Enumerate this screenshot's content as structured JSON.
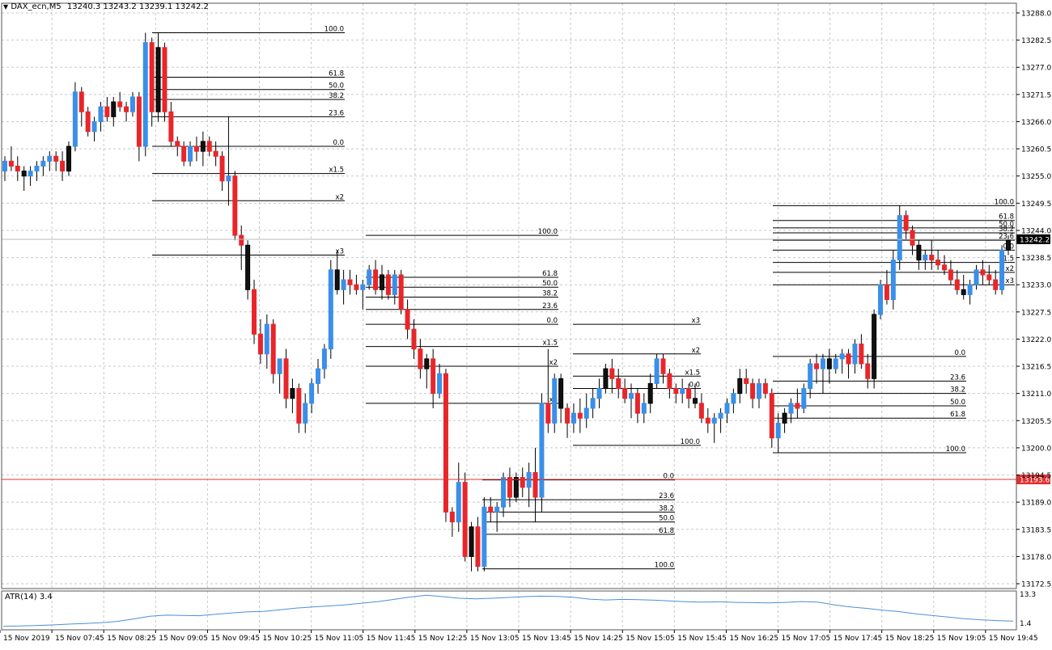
{
  "header": {
    "symbol_label": "DAX_ecn,M5",
    "ohlc_label": "13240.3 13243.2 13239.1 13242.2"
  },
  "indicator": {
    "label": "ATR(14) 3.4",
    "axis_top": "13.3",
    "axis_bottom": "1.4"
  },
  "price_axis": {
    "labels": [
      "13288.0",
      "13282.5",
      "13277.0",
      "13271.5",
      "13266.0",
      "13260.5",
      "13255.0",
      "13249.5",
      "13244.0",
      "13238.5",
      "13233.0",
      "13227.5",
      "13222.0",
      "13216.5",
      "13211.0",
      "13205.5",
      "13200.0",
      "13194.5",
      "13189.0",
      "13183.5",
      "13178.0",
      "13172.5"
    ],
    "current_price": "13242.2",
    "red_line_price": "13193.6"
  },
  "time_axis": {
    "labels": [
      "15 Nov 2019",
      "15 Nov 07:45",
      "15 Nov 08:25",
      "15 Nov 09:05",
      "15 Nov 09:45",
      "15 Nov 10:25",
      "15 Nov 11:05",
      "15 Nov 11:45",
      "15 Nov 12:25",
      "15 Nov 13:05",
      "15 Nov 13:45",
      "15 Nov 14:25",
      "15 Nov 15:05",
      "15 Nov 15:45",
      "15 Nov 16:25",
      "15 Nov 17:05",
      "15 Nov 17:45",
      "15 Nov 18:25",
      "15 Nov 19:05",
      "15 Nov 19:45"
    ]
  },
  "colors": {
    "bull": "#3a8fe8",
    "bear": "#e8262a",
    "neutral": "#111111",
    "grid": "#c8c8c8",
    "red_line": "#e03030",
    "atr": "#4a90d9",
    "fib_lines": "#000000"
  },
  "chart_data": {
    "type": "candlestick",
    "symbol": "DAX_ecn",
    "timeframe": "M5",
    "ylim": [
      13172.5,
      13288.0
    ],
    "candles": [
      [
        13256,
        13259,
        13254,
        13258
      ],
      [
        13258,
        13261,
        13256,
        13257
      ],
      [
        13257,
        13259,
        13254,
        13256
      ],
      [
        13256,
        13257,
        13252,
        13255
      ],
      [
        13255,
        13257,
        13253,
        13256
      ],
      [
        13256,
        13258,
        13254,
        13257
      ],
      [
        13257,
        13259,
        13255,
        13258
      ],
      [
        13258,
        13260,
        13256,
        13259
      ],
      [
        13259,
        13260,
        13256,
        13258
      ],
      [
        13258,
        13260,
        13254,
        13256
      ],
      [
        13256,
        13262,
        13255,
        13261
      ],
      [
        13261,
        13274,
        13260,
        13272
      ],
      [
        13272,
        13273,
        13265,
        13268
      ],
      [
        13268,
        13269,
        13263,
        13264
      ],
      [
        13264,
        13267,
        13262,
        13266
      ],
      [
        13266,
        13270,
        13264,
        13269
      ],
      [
        13269,
        13271,
        13266,
        13267
      ],
      [
        13267,
        13271,
        13265,
        13270
      ],
      [
        13270,
        13272,
        13268,
        13269
      ],
      [
        13269,
        13270,
        13266,
        13268
      ],
      [
        13268,
        13272,
        13267,
        13271
      ],
      [
        13271,
        13272,
        13258,
        13261
      ],
      [
        13261,
        13284,
        13259,
        13282
      ],
      [
        13282,
        13283,
        13265,
        13268
      ],
      [
        13268,
        13284,
        13266,
        13281
      ],
      [
        13281,
        13282,
        13266,
        13268
      ],
      [
        13268,
        13270,
        13261,
        13262
      ],
      [
        13262,
        13263,
        13259,
        13261
      ],
      [
        13261,
        13262,
        13257,
        13258
      ],
      [
        13258,
        13262,
        13257,
        13261
      ],
      [
        13261,
        13263,
        13258,
        13260
      ],
      [
        13260,
        13264,
        13257,
        13262
      ],
      [
        13262,
        13263,
        13259,
        13260
      ],
      [
        13260,
        13262,
        13257,
        13259
      ],
      [
        13259,
        13260,
        13252,
        13254
      ],
      [
        13254,
        13267,
        13249,
        13255
      ],
      [
        13255,
        13256,
        13242,
        13243
      ],
      [
        13243,
        13245,
        13236,
        13241
      ],
      [
        13241,
        13242,
        13230,
        13232
      ],
      [
        13232,
        13234,
        13221,
        13223
      ],
      [
        13223,
        13226,
        13217,
        13219
      ],
      [
        13219,
        13227,
        13216,
        13225
      ],
      [
        13225,
        13226,
        13213,
        13215
      ],
      [
        13215,
        13218,
        13211,
        13218
      ],
      [
        13218,
        13220,
        13208,
        13210
      ],
      [
        13210,
        13214,
        13207,
        13212
      ],
      [
        13212,
        13213,
        13203,
        13205
      ],
      [
        13205,
        13211,
        13203,
        13209
      ],
      [
        13209,
        13214,
        13207,
        13213
      ],
      [
        13213,
        13218,
        13211,
        13216
      ],
      [
        13216,
        13221,
        13214,
        13220
      ],
      [
        13220,
        13238,
        13218,
        13236
      ],
      [
        13236,
        13240,
        13231,
        13232
      ],
      [
        13232,
        13236,
        13229,
        13234
      ],
      [
        13234,
        13236,
        13231,
        13233
      ],
      [
        13233,
        13235,
        13231,
        13232
      ],
      [
        13232,
        13234,
        13228,
        13233
      ],
      [
        13233,
        13237,
        13232,
        13236
      ],
      [
        13236,
        13238,
        13231,
        13232
      ],
      [
        13232,
        13237,
        13230,
        13235
      ],
      [
        13235,
        13236,
        13230,
        13231
      ],
      [
        13231,
        13236,
        13229,
        13235
      ],
      [
        13235,
        13236,
        13227,
        13228
      ],
      [
        13228,
        13230,
        13222,
        13224
      ],
      [
        13224,
        13226,
        13218,
        13220
      ],
      [
        13220,
        13222,
        13214,
        13216
      ],
      [
        13216,
        13219,
        13212,
        13218
      ],
      [
        13218,
        13220,
        13208,
        13211
      ],
      [
        13211,
        13217,
        13210,
        13215
      ],
      [
        13215,
        13216,
        13185,
        13187
      ],
      [
        13187,
        13188,
        13182,
        13185
      ],
      [
        13185,
        13197,
        13183,
        13193
      ],
      [
        13193,
        13195,
        13177,
        13178
      ],
      [
        13178,
        13185,
        13175,
        13184
      ],
      [
        13184,
        13186,
        13175,
        13176
      ],
      [
        13176,
        13190,
        13175,
        13188
      ],
      [
        13188,
        13190,
        13185,
        13187
      ],
      [
        13187,
        13189,
        13183,
        13188
      ],
      [
        13188,
        13195,
        13186,
        13194
      ],
      [
        13194,
        13196,
        13188,
        13190
      ],
      [
        13190,
        13195,
        13189,
        13194
      ],
      [
        13194,
        13196,
        13190,
        13192
      ],
      [
        13192,
        13197,
        13188,
        13195
      ],
      [
        13195,
        13200,
        13185,
        13190
      ],
      [
        13190,
        13211,
        13187,
        13209
      ],
      [
        13209,
        13220,
        13203,
        13205
      ],
      [
        13205,
        13215,
        13203,
        13214
      ],
      [
        13214,
        13215,
        13205,
        13208
      ],
      [
        13208,
        13209,
        13202,
        13205
      ],
      [
        13205,
        13209,
        13203,
        13207
      ],
      [
        13207,
        13210,
        13203,
        13206
      ],
      [
        13206,
        13211,
        13204,
        13208
      ],
      [
        13208,
        13212,
        13206,
        13210
      ],
      [
        13210,
        13214,
        13208,
        13212
      ],
      [
        13212,
        13217,
        13211,
        13216
      ],
      [
        13216,
        13218,
        13211,
        13214
      ],
      [
        13214,
        13216,
        13210,
        13212
      ],
      [
        13212,
        13214,
        13209,
        13210
      ],
      [
        13210,
        13213,
        13206,
        13211
      ],
      [
        13211,
        13212,
        13205,
        13207
      ],
      [
        13207,
        13211,
        13205,
        13209
      ],
      [
        13209,
        13215,
        13207,
        13213
      ],
      [
        13213,
        13219,
        13212,
        13218
      ],
      [
        13218,
        13219,
        13213,
        13215
      ],
      [
        13215,
        13216,
        13210,
        13212
      ],
      [
        13212,
        13213,
        13209,
        13211
      ],
      [
        13211,
        13214,
        13209,
        13212
      ],
      [
        13212,
        13213,
        13208,
        13210
      ],
      [
        13210,
        13213,
        13208,
        13209
      ],
      [
        13209,
        13211,
        13205,
        13206
      ],
      [
        13206,
        13208,
        13203,
        13205
      ],
      [
        13205,
        13207,
        13201,
        13206
      ],
      [
        13206,
        13208,
        13203,
        13207
      ],
      [
        13207,
        13210,
        13205,
        13209
      ],
      [
        13209,
        13212,
        13207,
        13211
      ],
      [
        13211,
        13216,
        13209,
        13214
      ],
      [
        13214,
        13216,
        13211,
        13213
      ],
      [
        13213,
        13214,
        13208,
        13210
      ],
      [
        13210,
        13214,
        13208,
        13213
      ],
      [
        13213,
        13214,
        13210,
        13211
      ],
      [
        13211,
        13212,
        13200,
        13202
      ],
      [
        13202,
        13207,
        13199,
        13205
      ],
      [
        13205,
        13208,
        13203,
        13207
      ],
      [
        13207,
        13210,
        13205,
        13209
      ],
      [
        13209,
        13212,
        13206,
        13208
      ],
      [
        13208,
        13213,
        13207,
        13212
      ],
      [
        13212,
        13218,
        13210,
        13217
      ],
      [
        13217,
        13219,
        13213,
        13216
      ],
      [
        13216,
        13219,
        13211,
        13218
      ],
      [
        13218,
        13220,
        13213,
        13216
      ],
      [
        13216,
        13219,
        13215,
        13218
      ],
      [
        13218,
        13220,
        13215,
        13219
      ],
      [
        13219,
        13220,
        13214,
        13217
      ],
      [
        13217,
        13222,
        13215,
        13221
      ],
      [
        13221,
        13223,
        13216,
        13217
      ],
      [
        13217,
        13219,
        13212,
        13214
      ],
      [
        13214,
        13228,
        13212,
        13227
      ],
      [
        13227,
        13234,
        13226,
        13233
      ],
      [
        13233,
        13236,
        13229,
        13230
      ],
      [
        13230,
        13240,
        13228,
        13238
      ],
      [
        13238,
        13249,
        13236,
        13247
      ],
      [
        13247,
        13248,
        13242,
        13244
      ],
      [
        13244,
        13245,
        13239,
        13241
      ],
      [
        13241,
        13242,
        13236,
        13238
      ],
      [
        13238,
        13240,
        13236,
        13239
      ],
      [
        13239,
        13242,
        13236,
        13238
      ],
      [
        13238,
        13240,
        13236,
        13237
      ],
      [
        13237,
        13239,
        13235,
        13236
      ],
      [
        13236,
        13238,
        13233,
        13234
      ],
      [
        13234,
        13236,
        13231,
        13232
      ],
      [
        13232,
        13235,
        13230,
        13231
      ],
      [
        13231,
        13234,
        13229,
        13233
      ],
      [
        13233,
        13237,
        13232,
        13236
      ],
      [
        13236,
        13238,
        13233,
        13235
      ],
      [
        13235,
        13237,
        13233,
        13234
      ],
      [
        13234,
        13236,
        13231,
        13232
      ],
      [
        13232,
        13241,
        13231,
        13240
      ],
      [
        13240,
        13243,
        13239,
        13242
      ]
    ],
    "current_price": 13242.2,
    "horizontal_line": 13193.6,
    "fibonacci_groups": [
      {
        "labels": [
          "100.0",
          "61.8",
          "50.0",
          "38.2",
          "23.6",
          "0.0",
          "x1.5",
          "x2",
          "x3"
        ],
        "levels": [
          13284,
          13275,
          13272.5,
          13270.5,
          13267,
          13261,
          13255.5,
          13250,
          13239
        ]
      },
      {
        "labels": [
          "100.0",
          "61.8",
          "50.0",
          "38.2",
          "23.6",
          "0.0",
          "x1.5",
          "x2",
          "x3"
        ],
        "levels": [
          13243,
          13234.5,
          13232.5,
          13230.5,
          13228,
          13225,
          13220.5,
          13216.5,
          13209
        ]
      },
      {
        "labels": [
          "0.0",
          "23.6",
          "38.2",
          "50.0",
          "61.8",
          "100.0"
        ],
        "levels": [
          13193.5,
          13189.5,
          13187,
          13185,
          13182.5,
          13175.5
        ]
      },
      {
        "labels": [
          "x3",
          "x2",
          "x1.5",
          "0.0",
          "100.0"
        ],
        "levels": [
          13225,
          13219,
          13214.5,
          13212,
          13200.5
        ]
      },
      {
        "labels": [
          "100.0",
          "61.8",
          "50.0",
          "38.2",
          "23.6",
          "0.0",
          "x1.5",
          "x2",
          "x3"
        ],
        "levels": [
          13249,
          13246,
          13244.5,
          13243.5,
          13242,
          13240,
          13237.5,
          13235.5,
          13233
        ]
      },
      {
        "labels": [
          "0.0",
          "23.6",
          "38.2",
          "50.0",
          "61.8",
          "100.0"
        ],
        "levels": [
          13218.5,
          13213.5,
          13211,
          13208.5,
          13206,
          13199
        ]
      }
    ],
    "atr": {
      "label": "ATR(14)",
      "value": 3.4,
      "ylim": [
        1.4,
        13.3
      ],
      "values": [
        1.5,
        1.6,
        1.8,
        2.0,
        2.3,
        2.5,
        2.8,
        3.3,
        4.2,
        5.2,
        5.6,
        5.5,
        5.4,
        5.9,
        6.4,
        6.8,
        7.0,
        7.6,
        8.2,
        8.6,
        9.0,
        9.4,
        10.0,
        10.6,
        11.4,
        12.3,
        12.9,
        12.4,
        11.8,
        11.6,
        11.8,
        12.1,
        12.4,
        12.6,
        12.5,
        12.2,
        11.5,
        11.2,
        11.4,
        11.3,
        11.1,
        10.8,
        10.5,
        10.4,
        10.5,
        10.3,
        10.2,
        10.1,
        10.3,
        10.6,
        10.4,
        9.4,
        8.6,
        8.1,
        7.4,
        6.9,
        6.1,
        5.5,
        4.9,
        4.3,
        3.9,
        3.6,
        3.4
      ]
    },
    "xlabel": "",
    "ylabel": ""
  }
}
